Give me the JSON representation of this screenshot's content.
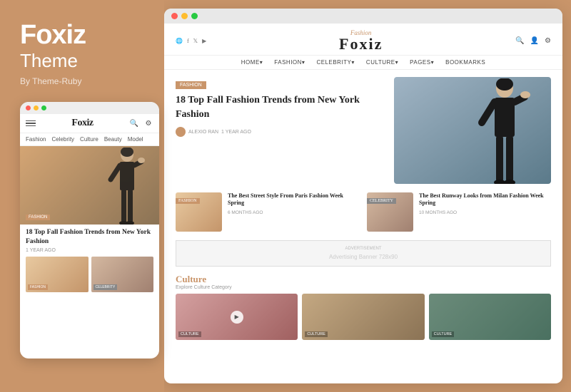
{
  "brand": {
    "name": "Foxiz",
    "subtitle": "Theme",
    "by": "By Theme-Ruby"
  },
  "mobile": {
    "logo": "Foxiz",
    "nav_items": [
      "Fashion",
      "Celebrity",
      "Culture",
      "Beauty",
      "Model"
    ],
    "hero_badge": "FASHION",
    "hero_title": "18 Top Fall Fashion Trends from New York Fashion",
    "hero_meta": "1 YEAR AGO",
    "sub1_badge": "FASHION",
    "sub2_badge": "CELEBRITY"
  },
  "desktop": {
    "logo_script": "Fashion",
    "logo_main": "Foxiz",
    "nav_items": [
      "HOME▾",
      "FASHION▾",
      "CELEBRITY▾",
      "CULTURE▾",
      "PAGES▾",
      "BOOKMARKS"
    ],
    "hero_badge": "FASHION",
    "hero_title": "18 Top Fall Fashion Trends from New York Fashion",
    "hero_author": "ALEXIO RAN",
    "hero_meta": "1 YEAR AGO",
    "sub1_badge": "FASHION",
    "sub1_title": "The Best Street Style From Paris Fashion Week Spring",
    "sub1_meta": "6 MONTHS AGO",
    "sub2_badge": "CELEBRITY",
    "sub2_title": "The Best Runway Looks from Milan Fashion Week Spring",
    "sub2_meta": "10 MONTHS AGO",
    "ad_label": "ADVERTISEMENT",
    "ad_text": "Advertising Banner 728x90",
    "culture_title": "Culture",
    "culture_subtitle": "Explore Culture Category",
    "culture_badge_1": "CULTURE",
    "culture_badge_2": "CULTURE",
    "culture_badge_3": "CULTURE"
  },
  "dots": {
    "red": "#FF5F57",
    "yellow": "#FFBD2E",
    "green": "#28CA41"
  },
  "colors": {
    "accent": "#C9956A",
    "bg": "#C9956A"
  }
}
